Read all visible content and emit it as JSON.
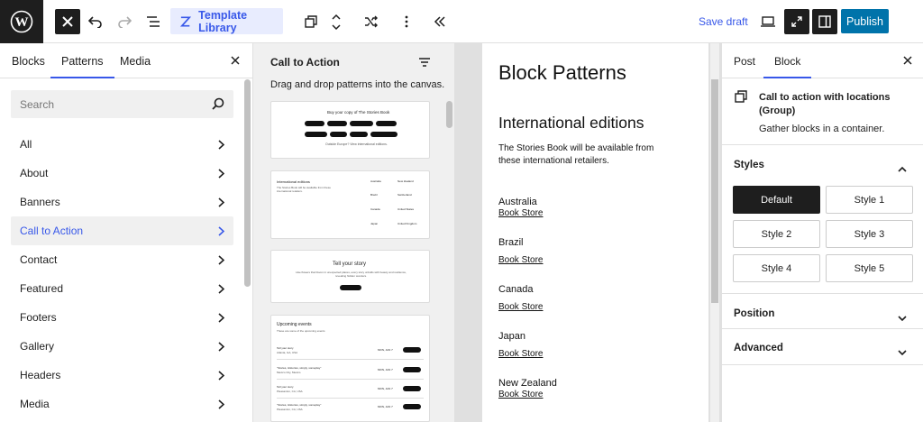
{
  "toolbar": {
    "template_library_label": "Template Library",
    "save_draft_label": "Save draft",
    "publish_label": "Publish"
  },
  "inserter": {
    "tabs": [
      "Blocks",
      "Patterns",
      "Media"
    ],
    "active_tab": "Patterns",
    "search_placeholder": "Search",
    "categories": [
      "All",
      "About",
      "Banners",
      "Call to Action",
      "Contact",
      "Featured",
      "Footers",
      "Gallery",
      "Headers",
      "Media"
    ],
    "active_category": "Call to Action"
  },
  "patterns_panel": {
    "title": "Call to Action",
    "description": "Drag and drop patterns into the canvas.",
    "card1": {
      "heading": "Buy your copy of The Stories Book",
      "buttons": [
        "Amazon",
        "Audible",
        "Barnes & Noble",
        "Apple Books",
        "Bookshop.org",
        "Spotify",
        "BAM!",
        "Simon & Schuster"
      ],
      "footer": "Outside Europe? View international editions."
    },
    "card2": {
      "heading": "International editions",
      "text": "The Stories Book will be available from these international retailers.",
      "cities": [
        "Australia",
        "New Zealand",
        "Brazil",
        "Switzerland",
        "Canada",
        "United States",
        "Japan",
        "United Kingdom"
      ],
      "store": "Book Store"
    },
    "card3": {
      "heading": "Tell your story",
      "text": "Like flowers that bloom in unexpected places, every story unfolds with beauty and resilience, revealing hidden wonders.",
      "button": "Learn more"
    },
    "card4": {
      "heading": "Upcoming events",
      "subheading": "These are some of the upcoming events",
      "rows": [
        {
          "title": "Tell your story",
          "place": "Atlanta, GA, USA",
          "date": "MON, JAN 7",
          "button": "Buy Tickets"
        },
        {
          "title": "\"Stories, Histories, simply, someplay\"",
          "place": "Mexico City, Mexico",
          "date": "MON, JAN 7",
          "button": "Buy Tickets"
        },
        {
          "title": "Tell your story",
          "place": "Pleasanton, CA, USA",
          "date": "MON, JAN 7",
          "button": "Buy Tickets"
        },
        {
          "title": "\"Stories, Histories, simply, someplay\"",
          "place": "Pleasanton, CA, USA",
          "date": "MON, JAN 7",
          "button": "Buy Tickets"
        }
      ]
    }
  },
  "canvas": {
    "page_title": "Block Patterns",
    "heading": "International editions",
    "paragraph": "The Stories Book will be available from these international retailers.",
    "locations": [
      {
        "city": "Australia",
        "store": "Book Store"
      },
      {
        "city": "Brazil",
        "store": "Book Store"
      },
      {
        "city": "Canada",
        "store": "Book Store"
      },
      {
        "city": "Japan",
        "store": "Book Store"
      },
      {
        "city": "New Zealand",
        "store": "Book Store"
      }
    ]
  },
  "settings": {
    "tabs": [
      "Post",
      "Block"
    ],
    "active_tab": "Block",
    "block_name": "Call to action with locations (Group)",
    "block_desc": "Gather blocks in a container.",
    "styles_title": "Styles",
    "styles": [
      "Default",
      "Style 1",
      "Style 2",
      "Style 3",
      "Style 4",
      "Style 5"
    ],
    "active_style": "Default",
    "position_title": "Position",
    "advanced_title": "Advanced"
  },
  "colors": {
    "accent": "#3858e9",
    "publish": "#0073aa",
    "dark": "#1e1e1e"
  }
}
